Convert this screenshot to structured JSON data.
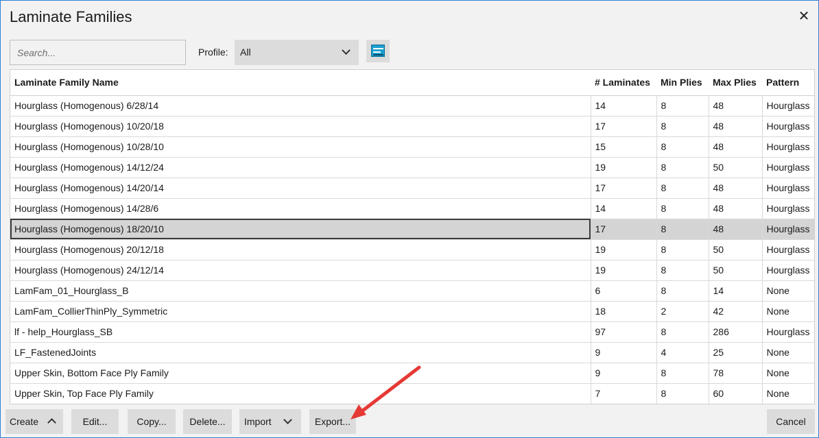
{
  "window": {
    "title": "Laminate Families",
    "close_label": "✕"
  },
  "search": {
    "placeholder": "Search...",
    "value": ""
  },
  "profile": {
    "label": "Profile:",
    "value": "All"
  },
  "table": {
    "columns": [
      "Laminate Family Name",
      "# Laminates",
      "Min Plies",
      "Max Plies",
      "Pattern"
    ],
    "rows": [
      [
        "Hourglass (Homogenous) 6/28/14",
        "14",
        "8",
        "48",
        "Hourglass"
      ],
      [
        "Hourglass (Homogenous) 10/20/18",
        "17",
        "8",
        "48",
        "Hourglass"
      ],
      [
        "Hourglass (Homogenous) 10/28/10",
        "15",
        "8",
        "48",
        "Hourglass"
      ],
      [
        "Hourglass (Homogenous) 14/12/24",
        "19",
        "8",
        "50",
        "Hourglass"
      ],
      [
        "Hourglass (Homogenous) 14/20/14",
        "17",
        "8",
        "48",
        "Hourglass"
      ],
      [
        "Hourglass (Homogenous) 14/28/6",
        "14",
        "8",
        "48",
        "Hourglass"
      ],
      [
        "Hourglass (Homogenous) 18/20/10",
        "17",
        "8",
        "48",
        "Hourglass"
      ],
      [
        "Hourglass (Homogenous) 20/12/18",
        "19",
        "8",
        "50",
        "Hourglass"
      ],
      [
        "Hourglass (Homogenous) 24/12/14",
        "19",
        "8",
        "50",
        "Hourglass"
      ],
      [
        "LamFam_01_Hourglass_B",
        "6",
        "8",
        "14",
        "None"
      ],
      [
        "LamFam_CollierThinPly_Symmetric",
        "18",
        "2",
        "42",
        "None"
      ],
      [
        "lf - help_Hourglass_SB",
        "97",
        "8",
        "286",
        "Hourglass"
      ],
      [
        "LF_FastenedJoints",
        "9",
        "4",
        "25",
        "None"
      ],
      [
        "Upper Skin, Bottom Face Ply Family",
        "9",
        "8",
        "78",
        "None"
      ],
      [
        "Upper Skin, Top Face Ply Family",
        "7",
        "8",
        "60",
        "None"
      ]
    ],
    "selected_row": 6
  },
  "buttons": {
    "create": "Create",
    "edit": "Edit...",
    "copy": "Copy...",
    "delete": "Delete...",
    "import": "Import",
    "export": "Export...",
    "cancel": "Cancel"
  },
  "colors": {
    "accent": "#2b7fd4",
    "annotation_arrow": "#e53935",
    "selected_row": "#d4d4d4"
  },
  "icons": {
    "close": "close-icon",
    "grid": "grid-view-icon",
    "chevron": "chevron-down-icon",
    "create_chevron": "chevron-up-icon"
  }
}
